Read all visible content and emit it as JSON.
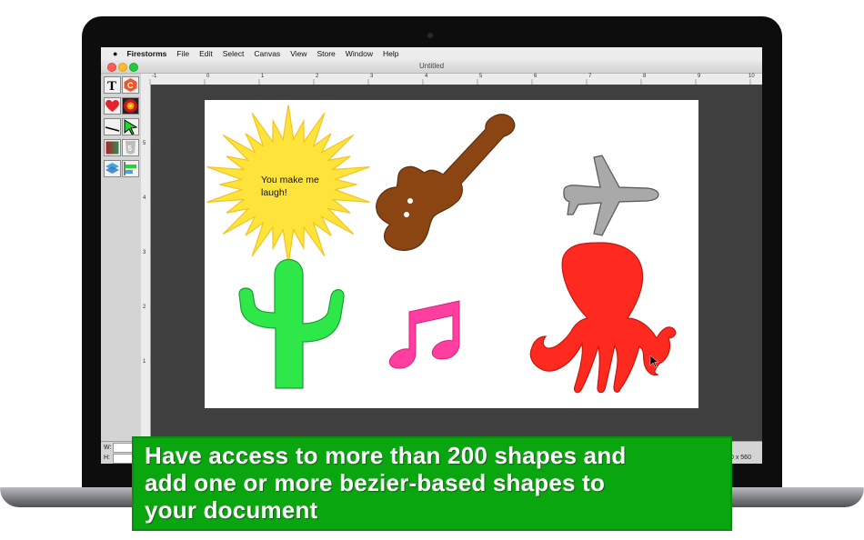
{
  "menubar": {
    "apple": "",
    "app_name": "Firestorms",
    "items": [
      "File",
      "Edit",
      "Select",
      "Canvas",
      "View",
      "Store",
      "Window",
      "Help"
    ]
  },
  "window": {
    "title": "Untitled",
    "controls": [
      "close",
      "minimize",
      "zoom"
    ]
  },
  "toolbar": {
    "tools": [
      {
        "name": "text-tool",
        "icon": "T"
      },
      {
        "name": "logo-tool",
        "icon": "C"
      },
      {
        "name": "shape-tool",
        "icon": "heart-icon"
      },
      {
        "name": "color-tool",
        "icon": "color-wheel-icon"
      },
      {
        "name": "line-tool",
        "icon": "line-icon"
      },
      {
        "name": "select-tool",
        "icon": "arrow-icon"
      },
      {
        "name": "gradient-tool",
        "icon": "gradient-icon"
      },
      {
        "name": "html5-tool",
        "icon": "html5-icon"
      },
      {
        "name": "layers-tool",
        "icon": "layers-icon"
      },
      {
        "name": "align-tool",
        "icon": "align-icon"
      }
    ]
  },
  "ruler": {
    "h_labels": [
      "-1",
      "0",
      "1",
      "2",
      "3",
      "4",
      "5",
      "6",
      "7",
      "8",
      "9",
      "10"
    ],
    "v_labels": [
      "5",
      "4",
      "3",
      "2",
      "1"
    ]
  },
  "canvas": {
    "burst_text_line1": "You make me",
    "burst_text_line2": "laugh!",
    "shapes": [
      "starburst",
      "violin",
      "airplane",
      "cactus",
      "music-note",
      "octopus"
    ]
  },
  "status": {
    "width_label": "W:",
    "height_label": "H:",
    "size_readout": "0 x 560"
  },
  "banner": {
    "line1": "Have access to more than 200 shapes and",
    "line2": "add one or more bezier-based shapes to",
    "line3": "your document"
  },
  "colors": {
    "banner": "#0aa60f",
    "starburst": "#fde33a",
    "violin": "#8b4513",
    "airplane": "#a9a9a9",
    "cactus": "#2ee84a",
    "music_note": "#ff3e9f",
    "octopus": "#ff2a1f"
  }
}
